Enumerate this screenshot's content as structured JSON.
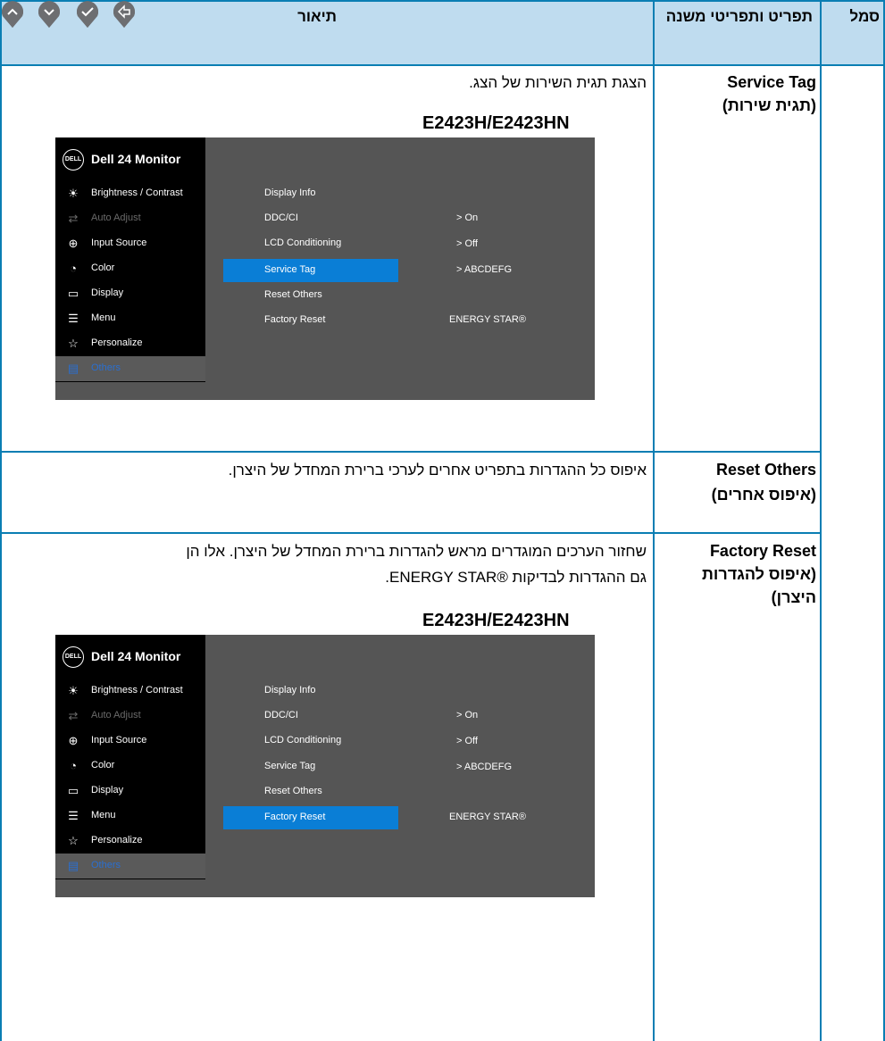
{
  "header": {
    "symbol": "סמל",
    "menu": "תפריט ותפריטי משנה",
    "description": "תיאור"
  },
  "rows": [
    {
      "name_en": "Service Tag",
      "name_he": "(תגית שירות)",
      "description": "הצגת תגית השירות של הצג.",
      "model": "E2423H/E2423HN"
    },
    {
      "name_en": "Reset Others",
      "name_he": "(איפוס אחרים)",
      "description": "איפוס כל ההגדרות בתפריט אחרים לערכי ברירת המחדל של היצרן."
    },
    {
      "name_en": "Factory Reset",
      "name_he_1": "(איפוס להגדרות",
      "name_he_2": "היצרן)",
      "description_1": "שחזור הערכים המוגדרים מראש להגדרות ברירת המחדל של היצרן. אלו הן",
      "description_2": "גם ההגדרות לבדיקות ®ENERGY STAR.",
      "model": "E2423H/E2423HN"
    }
  ],
  "osd": {
    "brand": "DELL",
    "title": "Dell 24 Monitor",
    "menu": [
      {
        "label": "Brightness / Contrast",
        "icon": "brightness-icon"
      },
      {
        "label": "Auto Adjust",
        "icon": "auto-adjust-icon"
      },
      {
        "label": "Input Source",
        "icon": "input-source-icon"
      },
      {
        "label": "Color",
        "icon": "color-icon"
      },
      {
        "label": "Display",
        "icon": "display-icon"
      },
      {
        "label": "Menu",
        "icon": "menu-icon"
      },
      {
        "label": "Personalize",
        "icon": "star-icon"
      },
      {
        "label": "Others",
        "icon": "others-icon"
      }
    ],
    "submenu": [
      "Display Info",
      "DDC/CI",
      "LCD Conditioning",
      "Service Tag",
      "Reset Others",
      "Factory Reset"
    ],
    "values": {
      "ddc": ">  On",
      "lcd": ">  Off",
      "tag": ">  ABCDEFG",
      "energy": "ENERGY STAR®"
    }
  }
}
